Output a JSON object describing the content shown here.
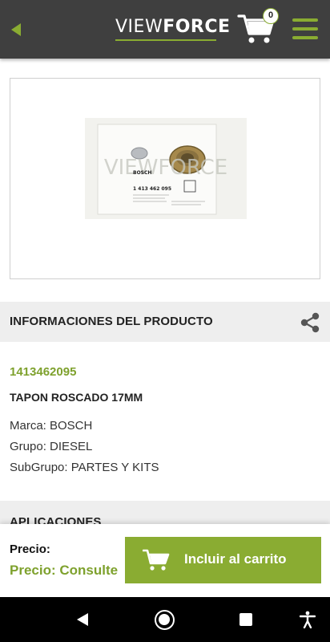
{
  "header": {
    "logo_text_light": "VIEW",
    "logo_text_bold": "FORCE",
    "cart_count": "0"
  },
  "product": {
    "image_alt": "VIEWFORCE",
    "package_brand": "BOSCH",
    "package_code": "1 413 462 095",
    "section_info_title": "INFORMACIONES DEL PRODUCTO",
    "code": "1413462095",
    "name": "TAPON ROSCADO 17MM",
    "attributes": [
      "Marca: BOSCH",
      "Grupo: DIESEL",
      "SubGrupo: PARTES Y KITS"
    ],
    "section_applications_title": "APLICACIONES"
  },
  "footer": {
    "price_label": "Precio:",
    "price_value": "Precio: Consulte",
    "add_to_cart_label": "Incluir al carrito"
  },
  "colors": {
    "accent": "#8aac32",
    "header_bg": "#3f3f3f",
    "code_text": "#7ea12d"
  },
  "icons": [
    "back-arrow-icon",
    "cart-icon",
    "menu-icon",
    "share-icon",
    "nav-back-icon",
    "nav-home-icon",
    "nav-recent-icon",
    "accessibility-icon"
  ]
}
